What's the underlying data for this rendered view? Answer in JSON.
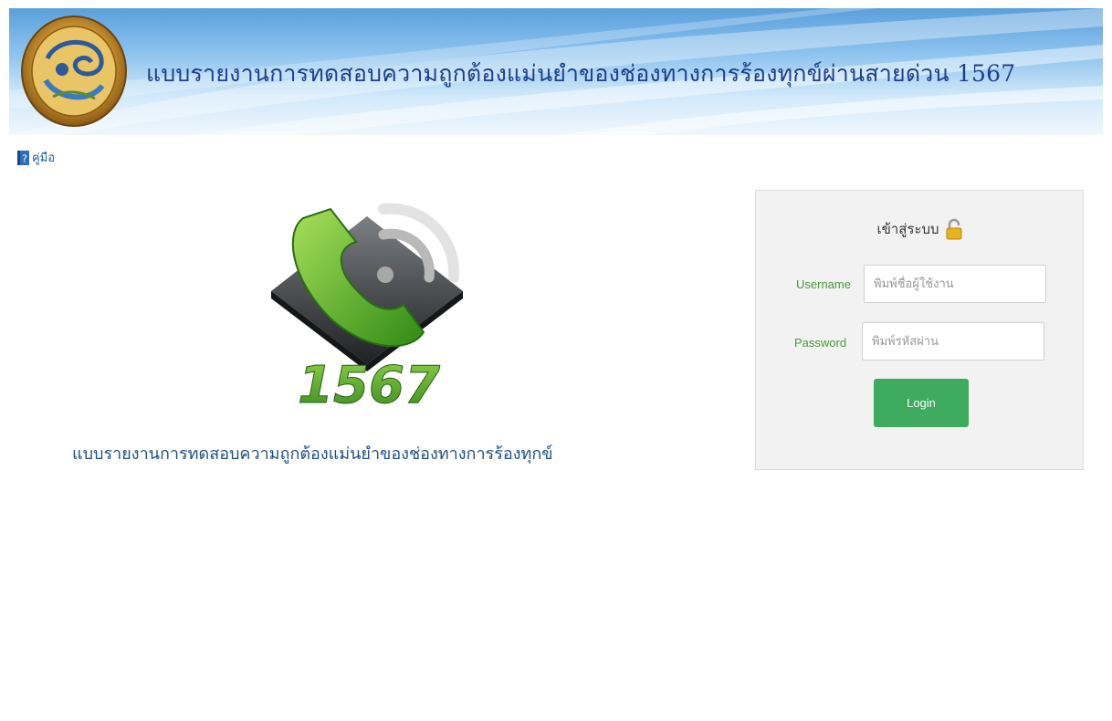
{
  "header": {
    "title": "แบบรายงานการทดสอบความถูกต้องแม่นยำของช่องทางการร้องทุกข์ผ่านสายด่วน 1567"
  },
  "manual": {
    "label": "คู่มือ",
    "icon": "help-book-icon"
  },
  "logo": {
    "number": "1567",
    "icon": "phone-wifi-logo"
  },
  "main": {
    "subtitle": "แบบรายงานการทดสอบความถูกต้องแม่นยำของช่องทางการร้องทุกข์"
  },
  "login": {
    "heading": "เข้าสู่ระบบ",
    "heading_icon": "open-lock-icon",
    "username_label": "Username",
    "username_placeholder": "พิมพ์ชื่อผู้ใช้งาน",
    "username_value": "",
    "password_label": "Password",
    "password_placeholder": "พิมพ์รหัสผ่าน",
    "password_value": "",
    "button_label": "Login"
  },
  "colors": {
    "title": "#1d3f8a",
    "label_green": "#4a9a3a",
    "button_green": "#3eab5f",
    "link": "#1a5fa0"
  }
}
